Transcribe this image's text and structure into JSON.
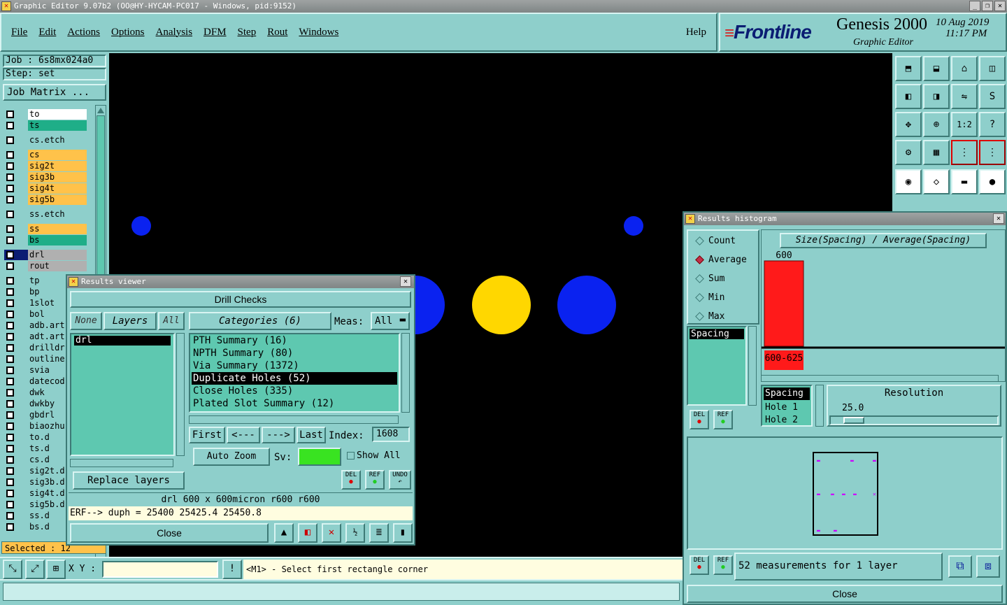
{
  "window": {
    "title": "Graphic Editor 9.07b2 (OO@HY-HYCAM-PC017 - Windows, pid:9152)"
  },
  "menu": [
    "File",
    "Edit",
    "Actions",
    "Options",
    "Analysis",
    "DFM",
    "Step",
    "Rout",
    "Windows"
  ],
  "help": "Help",
  "brand": {
    "logo": "Frontline",
    "product": "Genesis 2000",
    "subtitle": "Graphic Editor",
    "date": "10 Aug 2019",
    "time": "11:17 PM"
  },
  "job": {
    "label": "Job : 6s8mx024a0",
    "step": "Step: set",
    "matrix": "Job Matrix ..."
  },
  "layers": [
    {
      "name": "to",
      "color": "#ffffff"
    },
    {
      "name": "ts",
      "color": "#1fae88"
    },
    {
      "name": "cs.etch",
      "color": "#8ecfcb"
    },
    {
      "name": "cs",
      "color": "#ffc24a"
    },
    {
      "name": "sig2t",
      "color": "#ffc24a"
    },
    {
      "name": "sig3b",
      "color": "#ffc24a"
    },
    {
      "name": "sig4t",
      "color": "#ffc24a"
    },
    {
      "name": "sig5b",
      "color": "#ffc24a"
    },
    {
      "name": "ss.etch",
      "color": "#8ecfcb"
    },
    {
      "name": "ss",
      "color": "#ffc24a"
    },
    {
      "name": "bs",
      "color": "#1fae88"
    },
    {
      "name": "drl",
      "color": "#b0b0b0"
    },
    {
      "name": "rout",
      "color": "#b0b0b0"
    },
    {
      "name": "tp",
      "color": "#8ecfcb"
    },
    {
      "name": "bp",
      "color": "#8ecfcb"
    },
    {
      "name": "1slot",
      "color": "#8ecfcb"
    },
    {
      "name": "bol",
      "color": "#8ecfcb"
    },
    {
      "name": "adb.art",
      "color": "#8ecfcb"
    },
    {
      "name": "adt.art",
      "color": "#8ecfcb"
    },
    {
      "name": "drilldr",
      "color": "#8ecfcb"
    },
    {
      "name": "outline",
      "color": "#8ecfcb"
    },
    {
      "name": "svia",
      "color": "#8ecfcb"
    },
    {
      "name": "datecod",
      "color": "#8ecfcb"
    },
    {
      "name": "dwk",
      "color": "#8ecfcb"
    },
    {
      "name": "dwkby",
      "color": "#8ecfcb"
    },
    {
      "name": "gbdrl",
      "color": "#8ecfcb"
    },
    {
      "name": "biaozhu",
      "color": "#8ecfcb"
    },
    {
      "name": "to.d",
      "color": "#8ecfcb"
    },
    {
      "name": "ts.d",
      "color": "#8ecfcb"
    },
    {
      "name": "cs.d",
      "color": "#8ecfcb"
    },
    {
      "name": "sig2t.d",
      "color": "#8ecfcb"
    },
    {
      "name": "sig3b.d",
      "color": "#8ecfcb"
    },
    {
      "name": "sig4t.d",
      "color": "#8ecfcb"
    },
    {
      "name": "sig5b.d",
      "color": "#8ecfcb"
    },
    {
      "name": "ss.d",
      "color": "#8ecfcb"
    },
    {
      "name": "bs.d",
      "color": "#8ecfcb"
    }
  ],
  "selected": "Selected : 12",
  "bottom": {
    "xy_label": "X Y :",
    "xy_value": "",
    "prompt": "<M1> - Select first rectangle corner"
  },
  "results_viewer": {
    "title": "Results viewer",
    "header": "Drill Checks",
    "none": "None",
    "layers": "Layers",
    "all": "All",
    "categories": "Categories (6)",
    "meas_label": "Meas:",
    "meas_value": "All",
    "layer_list": [
      "drl"
    ],
    "category_list": [
      "PTH Summary (16)",
      "NPTH Summary (80)",
      "Via Summary (1372)",
      "Duplicate Holes (52)",
      "Close Holes (335)",
      "Plated Slot Summary (12)"
    ],
    "selected_category": "Duplicate Holes (52)",
    "first": "First",
    "prev": "<---",
    "next": "--->",
    "last": "Last",
    "index_label": "Index:",
    "index_value": "1608",
    "auto_zoom": "Auto Zoom",
    "sv_label": "Sv:",
    "show_all": "Show All",
    "replace_layers": "Replace layers",
    "del": "DEL",
    "ref": "REF",
    "undo": "UNDO",
    "info1": "drl  600 x 600micron  r600  r600",
    "info2": "ERF--> duph = 25400 25425.4 25450.8",
    "close": "Close"
  },
  "histogram": {
    "title": "Results histogram",
    "modes": [
      "Count",
      "Average",
      "Sum",
      "Min",
      "Max"
    ],
    "selected_mode": "Average",
    "chart_title": "Size(Spacing) / Average(Spacing)",
    "bar_value": "600",
    "bar_label": "600-625",
    "list": [
      "Spacing"
    ],
    "fields": [
      "Spacing",
      "Hole 1",
      "Hole 2"
    ],
    "resolution_label": "Resolution",
    "resolution_value": "25.0",
    "status": "52 measurements for 1 layer",
    "close": "Close",
    "del": "DEL",
    "ref": "REF"
  },
  "chart_data": {
    "type": "bar",
    "categories": [
      "600-625"
    ],
    "values": [
      600
    ],
    "title": "Size(Spacing) / Average(Spacing)",
    "xlabel": "",
    "ylabel": ""
  }
}
